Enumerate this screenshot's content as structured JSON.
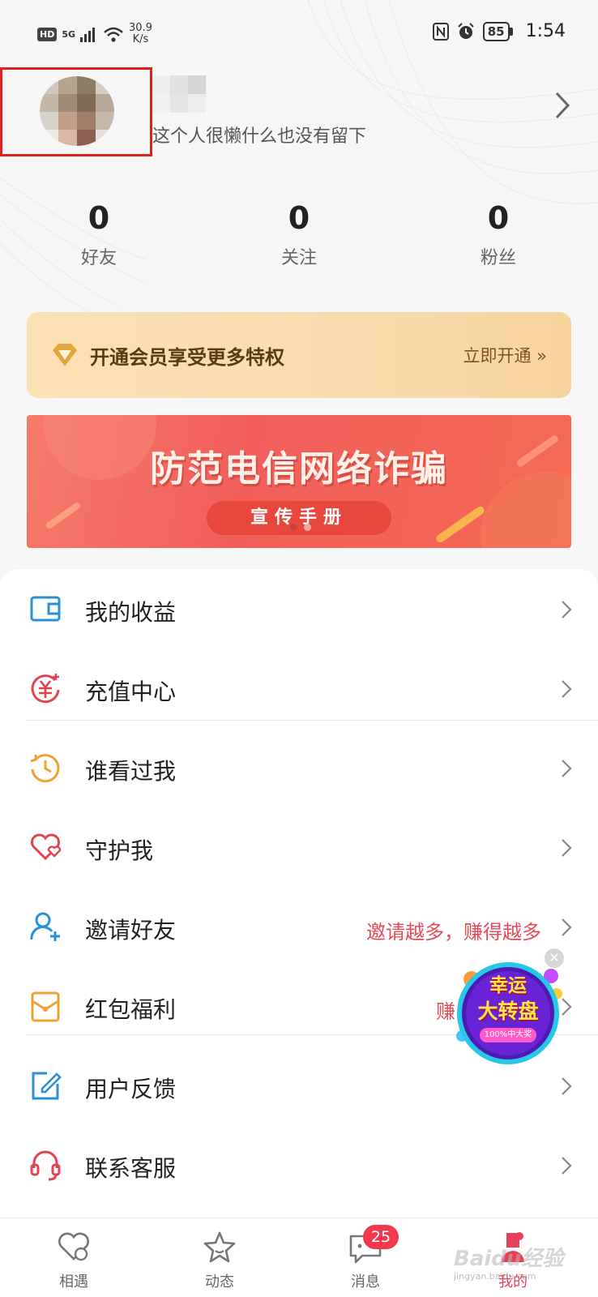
{
  "status_bar": {
    "hd": "HD",
    "network": "5G",
    "speed_value": "30.9",
    "speed_unit": "K/s",
    "battery": "85",
    "time": "1:54"
  },
  "profile": {
    "signature": "这个人很懒什么也没有留下"
  },
  "stats": [
    {
      "value": "0",
      "label": "好友"
    },
    {
      "value": "0",
      "label": "关注"
    },
    {
      "value": "0",
      "label": "粉丝"
    }
  ],
  "vip": {
    "text": "开通会员享受更多特权",
    "cta": "立即开通 »"
  },
  "promo": {
    "title": "防范电信网络诈骗",
    "subtitle": "宣传手册"
  },
  "menu": [
    {
      "label": "我的收益",
      "icon": "wallet-icon",
      "color": "#2a8fd9"
    },
    {
      "label": "充值中心",
      "icon": "recharge-yen-icon",
      "color": "#e2434f"
    },
    {
      "label": "谁看过我",
      "icon": "history-clock-icon",
      "color": "#f1a033"
    },
    {
      "label": "守护我",
      "icon": "heart-icon",
      "color": "#e2434f"
    },
    {
      "label": "邀请好友",
      "icon": "add-user-icon",
      "color": "#2a8fd9",
      "extra": "邀请越多，赚得越多"
    },
    {
      "label": "红包福利",
      "icon": "red-envelope-icon",
      "color": "#f1a033",
      "extra": "赚"
    },
    {
      "label": "用户反馈",
      "icon": "feedback-edit-icon",
      "color": "#2a8fd9"
    },
    {
      "label": "联系客服",
      "icon": "headset-icon",
      "color": "#e2434f"
    }
  ],
  "lucky_wheel": {
    "line1": "幸运",
    "line2": "大转盘",
    "line3": "100%中大奖"
  },
  "bottom_nav": [
    {
      "label": "相遇",
      "icon": "heart-chat-icon"
    },
    {
      "label": "动态",
      "icon": "star-icon"
    },
    {
      "label": "消息",
      "icon": "message-icon",
      "badge": "25"
    },
    {
      "label": "我的",
      "icon": "profile-icon",
      "active": true
    }
  ],
  "watermark": {
    "brand": "Baidu经验",
    "sub": "jingyan.baidu.com"
  },
  "colors": {
    "accent": "#e8405a",
    "avatar_highlight": "#e0211c",
    "vip_text": "#5a3b12"
  }
}
